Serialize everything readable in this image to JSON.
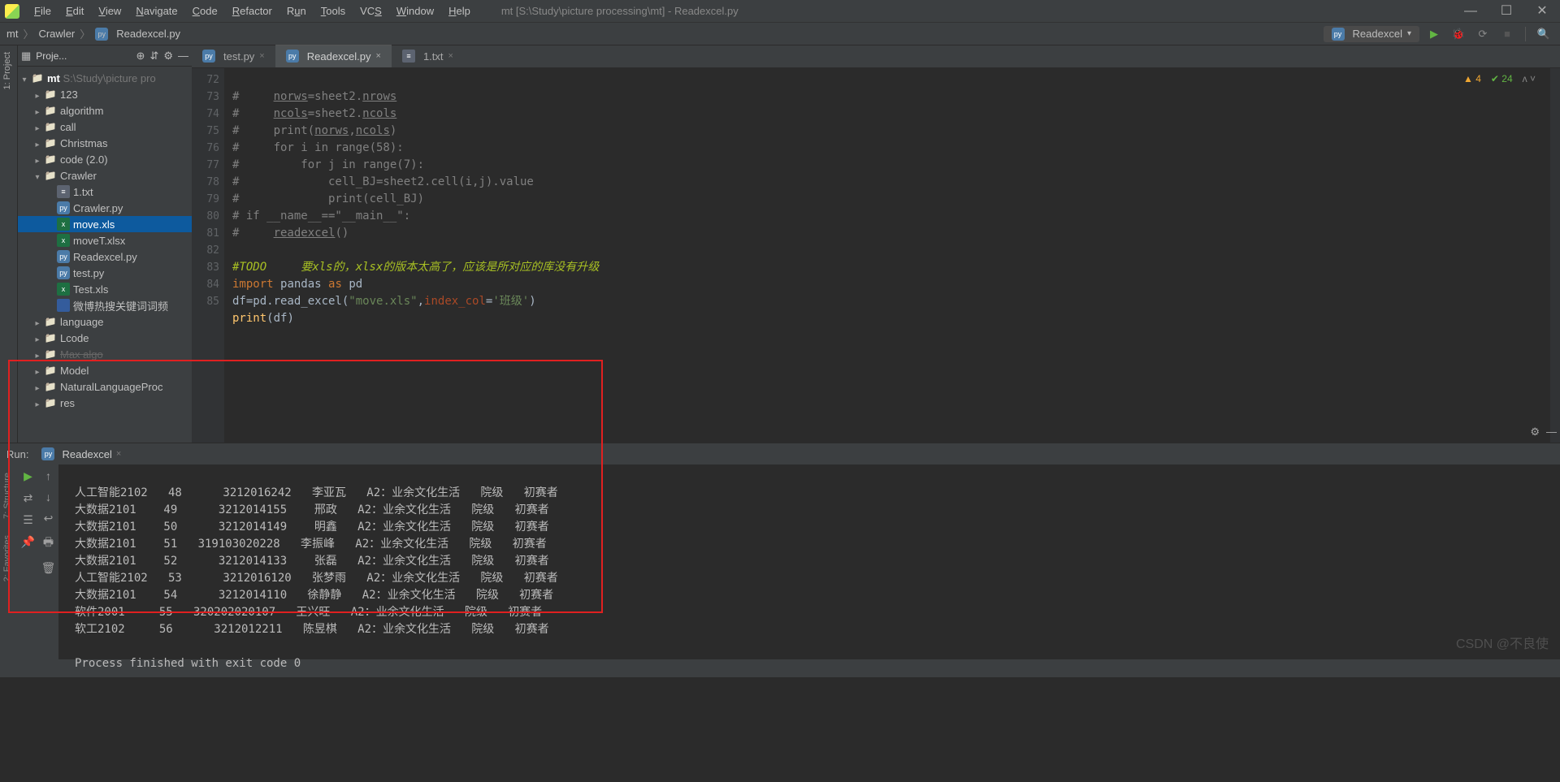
{
  "menu": {
    "file": "File",
    "edit": "Edit",
    "view": "View",
    "navigate": "Navigate",
    "code": "Code",
    "refactor": "Refactor",
    "run": "Run",
    "tools": "Tools",
    "vcs": "VCS",
    "window": "Window",
    "help": "Help"
  },
  "window_title": "mt [S:\\Study\\picture processing\\mt] - Readexcel.py",
  "breadcrumb": {
    "a": "mt",
    "b": "Crawler",
    "c": "Readexcel.py"
  },
  "run_config": "Readexcel",
  "project_label": "Proje...",
  "tree": {
    "root": "mt",
    "root_path": "S:\\Study\\picture pro",
    "d123": "123",
    "alg": "algorithm",
    "call": "call",
    "chr": "Christmas",
    "code20": "code   (2.0)",
    "crawler": "Crawler",
    "files": {
      "txt": "1.txt",
      "crawler": "Crawler.py",
      "move": "move.xls",
      "movet": "moveT.xlsx",
      "read": "Readexcel.py",
      "test": "test.py",
      "testx": "Test.xls",
      "weibo": "微博热搜关键词词频"
    },
    "lang": "language",
    "lcode": "Lcode",
    "maxalgo": "Max algo",
    "model": "Model",
    "nlp": "NaturalLanguageProc",
    "res": "res"
  },
  "tabs": {
    "test": "test.py",
    "read": "Readexcel.py",
    "txt": "1.txt"
  },
  "gutter": [
    "72",
    "73",
    "74",
    "75",
    "76",
    "77",
    "78",
    "79",
    "80",
    "81",
    "82",
    "83",
    "84",
    "85"
  ],
  "code": {
    "l72": "#     norws=sheet2.nrows",
    "l73": "#     ncols=sheet2.ncols",
    "l74": "#     print(norws,ncols)",
    "l75": "#     for i in range(58):",
    "l76": "#         for j in range(7):",
    "l77": "#             cell_BJ=sheet2.cell(i,j).value",
    "l78": "#             print(cell_BJ)",
    "l79": "# if __name__==\"__main__\":",
    "l80": "#     readexcel()",
    "l82_todo": "#TODO     要xls的，xlsx的版本太高了，应该是所对应的库没有升级",
    "l83_import": "import",
    "l83_pandas": "pandas",
    "l83_as": "as",
    "l83_pd": "pd",
    "l84_pre": "df=pd.read_excel(",
    "l84_str": "\"move.xls\"",
    "l84_mid": ",index_col=",
    "l84_str2": "'班级'",
    "l84_end": ")",
    "l85_print": "print",
    "l85_p": "(df)"
  },
  "inspection": {
    "warn": "4",
    "ok": "24"
  },
  "run_panel": {
    "title": "Run:",
    "tab": "Readexcel"
  },
  "console_lines": [
    "人工智能2102   48      3212016242   李亚瓦   A2：业余文化生活   院级   初赛者",
    "大数据2101    49      3212014155    邢政   A2：业余文化生活   院级   初赛者",
    "大数据2101    50      3212014149    明鑫   A2：业余文化生活   院级   初赛者",
    "大数据2101    51   319103020228   李振峰   A2：业余文化生活   院级   初赛者",
    "大数据2101    52      3212014133    张磊   A2：业余文化生活   院级   初赛者",
    "人工智能2102   53      3212016120   张梦雨   A2：业余文化生活   院级   初赛者",
    "大数据2101    54      3212014110   徐静静   A2：业余文化生活   院级   初赛者",
    "软件2001     55   320202020107   王兴旺   A2：业余文化生活   院级   初赛者",
    "软工2102     56      3212012211   陈昱棋   A2：业余文化生活   院级   初赛者",
    "",
    "Process finished with exit code 0"
  ],
  "left_tool": "1: Project",
  "left_tool2": "7: Structure",
  "left_tool3": "2: Favorites",
  "watermark": "CSDN @不良使"
}
